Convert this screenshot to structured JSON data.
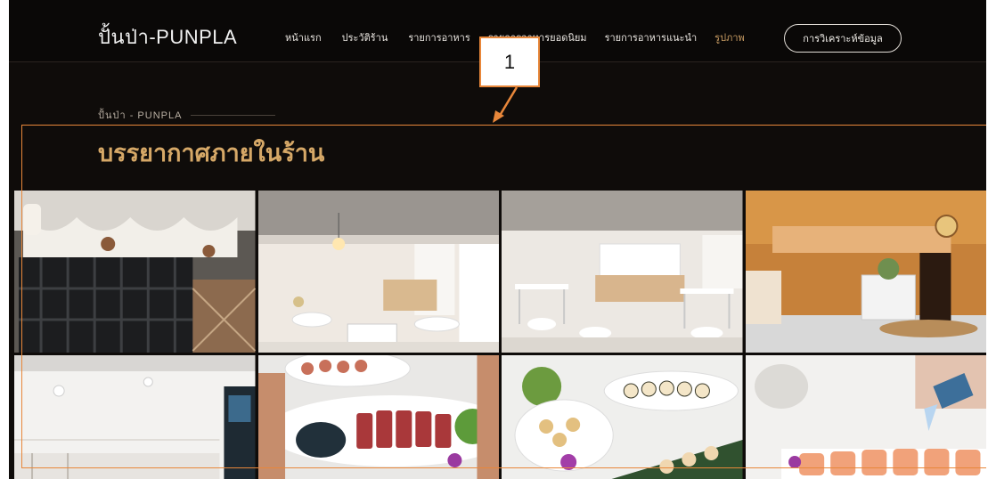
{
  "header": {
    "logo": "ปั้นป่า-PUNPLA",
    "nav": [
      {
        "label": "หน้าแรก",
        "active": false
      },
      {
        "label": "ประวัติร้าน",
        "active": false
      },
      {
        "label": "รายการอาหาร",
        "active": false
      },
      {
        "label": "รายการอาหารยอดนิยม",
        "active": false
      },
      {
        "label": "รายการอาหารแนะนำ",
        "active": false
      },
      {
        "label": "รูปภาพ",
        "active": true
      }
    ],
    "cta_label": "การวิเคราะห์ข้อมูล"
  },
  "section": {
    "breadcrumb": "ปั้นป่า - PUNPLA",
    "title": "บรรยากาศภายในร้าน"
  },
  "gallery": [
    {
      "name": "storefront-photo",
      "icon": "storefront-icon"
    },
    {
      "name": "dining-room-chandelier-photo",
      "icon": "interior-icon"
    },
    {
      "name": "dining-room-bar-photo",
      "icon": "interior-icon"
    },
    {
      "name": "table-plant-drink-photo",
      "icon": "plant-icon"
    },
    {
      "name": "white-room-photo",
      "icon": "interior-icon"
    },
    {
      "name": "seared-tuna-dish-photo",
      "icon": "food-icon"
    },
    {
      "name": "sushi-platter-photo",
      "icon": "food-icon"
    },
    {
      "name": "torch-sushi-photo",
      "icon": "food-icon"
    }
  ],
  "annotation": {
    "number": "1",
    "color": "#e8873a"
  },
  "colors": {
    "background": "#0f0c0a",
    "accent_gold": "#d6a867",
    "active_nav": "#c79b62"
  }
}
